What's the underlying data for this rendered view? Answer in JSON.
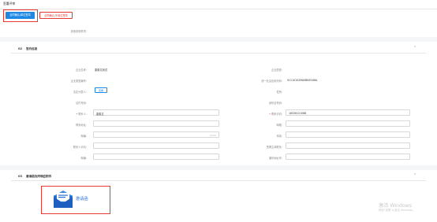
{
  "page": {
    "title": "签署评审"
  },
  "toolbar": {
    "btn_confirm": "合同确认/单位签章",
    "btn_reject": "合同确认/不单位签章"
  },
  "top_row": {
    "label": "其他说明事项："
  },
  "section2": {
    "index": "02",
    "title": "签约信息",
    "rows": [
      {
        "left_label": "企业名称：",
        "left_value": "康泰文测试",
        "right_label": "企业类型：",
        "right_value": ""
      },
      {
        "left_label": "企业类型编号：",
        "left_value": "",
        "right_label": "统一社会信用代码：",
        "right_value": "91110102MA0BKEGX6A"
      },
      {
        "left_label": "法定代表人：",
        "left_button": "查看",
        "right_label": "性别：",
        "right_value": ""
      },
      {
        "left_label": "证件号码：",
        "left_value": "",
        "right_label": "身份证号码：",
        "right_value": ""
      }
    ],
    "fields": {
      "contact_label": "联系人：",
      "contact_value": "康泰文",
      "mobile_label": "联系手机：",
      "mobile_value": "18326121088",
      "addr_label": "联系地址：",
      "email_label": "邮箱：",
      "postal_label": "邮编：",
      "postal_count": "0/200",
      "fax_label": "传真：",
      "contact_phone_label": "联系人手机：",
      "seal_label": "签署主体联系：",
      "bank_label": "邮编：",
      "account_label": "通讯地址号："
    }
  },
  "section3": {
    "index": "03",
    "title": "邀请函及同响应附件",
    "invite_label": "邀请函"
  },
  "watermark": {
    "line1": "激活 Windows",
    "line2": "转到\"设置\"以激活 Windows。"
  },
  "colors": {
    "primary": "#1e88e5",
    "highlight": "#e53935",
    "border": "#d8d8d8"
  }
}
